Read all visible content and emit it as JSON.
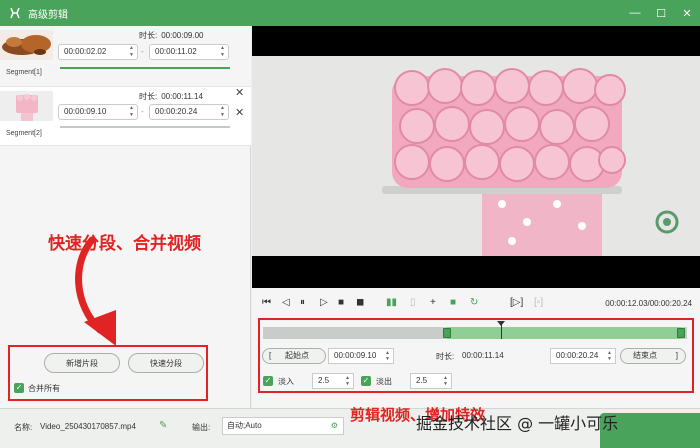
{
  "window": {
    "title": "高级剪辑",
    "minimize_glyph": "—",
    "maximize_glyph": "☐",
    "close_glyph": "✕"
  },
  "segments": [
    {
      "label": "Segment[1]",
      "duration_label": "时长:",
      "duration": "00:00:09.00",
      "start": "00:00:02.02",
      "end": "00:00:11.02"
    },
    {
      "label": "Segment[2]",
      "duration_label": "时长:",
      "duration": "00:00:11.14",
      "start": "00:00:09.10",
      "end": "00:00:20.24"
    }
  ],
  "segment_close_glyph": "✕",
  "segment_dash": "-",
  "left_actions": {
    "add_segment": "新增片段",
    "quick_split": "快速分段",
    "merge_all": "合并所有"
  },
  "annotations": {
    "left": "快速分段、合并视频",
    "right": "剪辑视频、增加特效"
  },
  "player": {
    "timecode": "00:00:12.03/00:00:20.24",
    "icons": [
      "skip-start-icon",
      "prev-frame-icon",
      "pause-icon",
      "next-frame-icon",
      "stop-icon",
      "volume-icon",
      "split-icon",
      "delete-icon",
      "add-icon",
      "copy-icon",
      "rotate-icon",
      "bracket-marker-icon",
      "snapshot-icon"
    ]
  },
  "trim": {
    "start_label": "起始点",
    "start_value": "00:00:09.10",
    "duration_label": "时长:",
    "duration_value": "00:00:11.14",
    "end_value": "00:00:20.24",
    "end_label": "结束点",
    "bracket_left": "[",
    "bracket_right": "]",
    "fade_in_label": "淡入",
    "fade_in_value": "2.5",
    "fade_out_label": "淡出",
    "fade_out_value": "2.5"
  },
  "bottom": {
    "name_label": "名称:",
    "name_value": "Video_250430170857.mp4",
    "output_label": "输出:",
    "output_value": "自动;Auto"
  },
  "watermark": "掘金技术社区 @ 一罐小可乐",
  "colors": {
    "accent": "#4aa35a",
    "annotation": "#e02424"
  }
}
